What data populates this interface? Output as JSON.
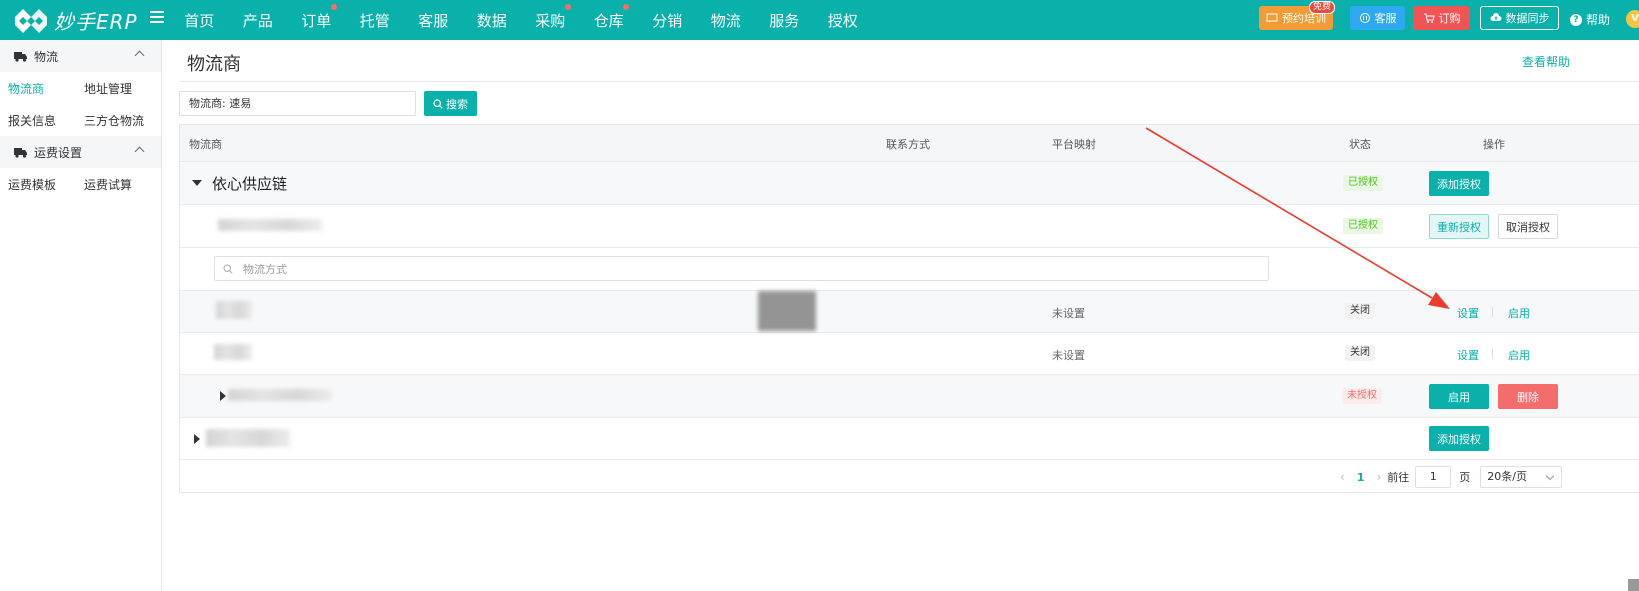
{
  "header": {
    "logo_text": "妙手ERP",
    "nav": [
      {
        "label": "首页",
        "dot": false
      },
      {
        "label": "产品",
        "dot": false
      },
      {
        "label": "订单",
        "dot": true
      },
      {
        "label": "托管",
        "dot": false
      },
      {
        "label": "客服",
        "dot": false
      },
      {
        "label": "数据",
        "dot": false
      },
      {
        "label": "采购",
        "dot": true
      },
      {
        "label": "仓库",
        "dot": true
      },
      {
        "label": "分销",
        "dot": false
      },
      {
        "label": "物流",
        "dot": false
      },
      {
        "label": "服务",
        "dot": false
      },
      {
        "label": "授权",
        "dot": false
      }
    ],
    "training_label": "预约培训",
    "free_badge": "免费",
    "service_label": "客服",
    "order_label": "订购",
    "sync_label": "数据同步",
    "help_label": "帮助",
    "vip_badge": "V"
  },
  "sidebar": {
    "groups": [
      {
        "title": "物流",
        "items": [
          [
            "物流商",
            "地址管理"
          ],
          [
            "报关信息",
            "三方仓物流"
          ]
        ]
      },
      {
        "title": "运费设置",
        "items": [
          [
            "运费模板",
            "运费试算"
          ]
        ]
      }
    ]
  },
  "main": {
    "title": "物流商",
    "view_help": "查看帮助",
    "filter_text": "物流商:  速易",
    "search_label": "搜索"
  },
  "table": {
    "headers": {
      "provider": "物流商",
      "contact": "联系方式",
      "mapping": "平台映射",
      "status": "状态",
      "action": "操作"
    },
    "group_row": {
      "name": "依心供应链",
      "status": "已授权",
      "action": "添加授权"
    },
    "account_row": {
      "status": "已授权",
      "reauth": "重新授权",
      "cancel": "取消授权"
    },
    "method_search_placeholder": "物流方式",
    "method_rows": [
      {
        "mapping": "未设置",
        "status": "关闭",
        "set": "设置",
        "enable": "启用"
      },
      {
        "mapping": "未设置",
        "status": "关闭",
        "set": "设置",
        "enable": "启用"
      }
    ],
    "unauth_row": {
      "status": "未授权",
      "enable": "启用",
      "delete": "删除"
    },
    "last_row": {
      "action": "添加授权"
    }
  },
  "pagination": {
    "prev": "‹",
    "current": "1",
    "next": "›",
    "goto_label": "前往",
    "goto_value": "1",
    "page_suffix": "页",
    "page_size": "20条/页"
  },
  "colors": {
    "brand": "#0ab0aa",
    "danger": "#f56c6c",
    "success": "#52c41a",
    "annotation_arrow": "#ee3b2e"
  }
}
